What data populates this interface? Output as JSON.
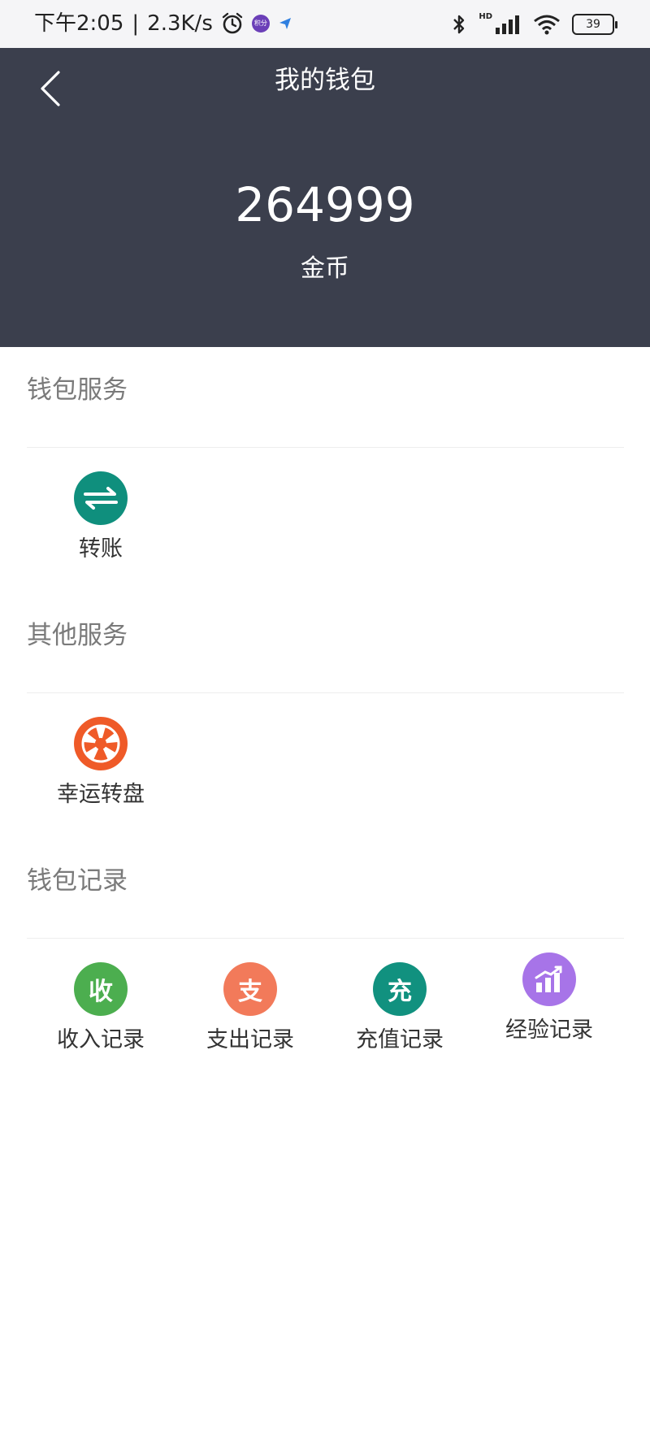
{
  "status_bar": {
    "time": "下午2:05",
    "separator": "|",
    "net_speed": "2.3K/s",
    "app_badge": "积分",
    "battery": "39",
    "hd": "HD",
    "icons": [
      "alarm-icon",
      "app-badge-icon",
      "location-icon",
      "bluetooth-icon",
      "signal-icon",
      "wifi-icon",
      "battery-icon"
    ]
  },
  "header": {
    "title": "我的钱包",
    "balance": "264999",
    "unit": "金币",
    "background_color": "#3b3f4d"
  },
  "sections": [
    {
      "title": "钱包服务",
      "items": [
        {
          "label": "转账",
          "icon": "transfer-icon",
          "color": "#0f8f7d"
        }
      ]
    },
    {
      "title": "其他服务",
      "items": [
        {
          "label": "幸运转盘",
          "icon": "lucky-wheel-icon",
          "color": "#ef5a28"
        }
      ]
    },
    {
      "title": "钱包记录",
      "items": [
        {
          "label": "收入记录",
          "icon": "income-icon",
          "glyph": "收",
          "color": "#4cae4f"
        },
        {
          "label": "支出记录",
          "icon": "expense-icon",
          "glyph": "支",
          "color": "#f27a5a"
        },
        {
          "label": "充值记录",
          "icon": "recharge-icon",
          "glyph": "充",
          "color": "#11917f"
        },
        {
          "label": "经验记录",
          "icon": "experience-icon",
          "color": "#a774e8"
        }
      ]
    }
  ]
}
